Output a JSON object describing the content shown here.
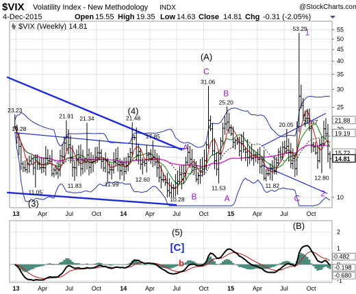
{
  "header": {
    "symbol": "$VIX",
    "name": "Volatility Index - New Methodology",
    "exchange": "INDX",
    "watermark": "@StockCharts.com",
    "date": "4-Dec-2015",
    "open_label": "Open",
    "open": "15.55",
    "high_label": "High",
    "high": "19.35",
    "low_label": "Low",
    "low": "14.63",
    "close_label": "Close",
    "close": "14.81",
    "chg_label": "Chg",
    "chg": "-0.31 (-2.05%)"
  },
  "legend": "$VIX (Weekly) 14.81",
  "colors": {
    "bars": "#000000",
    "ma_fast": "#d42020",
    "ma_slow": "#1a8a1a",
    "ma_long": "#e020c0",
    "bollinger": "#2030a0",
    "trend_lines": "#1a2adc",
    "wave_labels": "#9020c0",
    "macd_line": "#000000",
    "signal_line": "#c02020",
    "histogram": "#4a8a7a",
    "current_price_box": "#1a1a1a"
  },
  "chart_data": [
    {
      "type": "candlestick",
      "title": "$VIX (Weekly)",
      "y_scale": "log",
      "ylim": [
        9,
        60
      ],
      "y_ticks": [
        10,
        15,
        20,
        25,
        30,
        35,
        40,
        45,
        50,
        55
      ],
      "x_tick_labels": [
        "13",
        "Apr",
        "Jul",
        "Oct",
        "14",
        "Apr",
        "Jul",
        "Oct",
        "15",
        "Apr",
        "Jul",
        "Oct"
      ],
      "close_series": [
        {
          "x": "2012-12-28",
          "y": 20.5
        },
        {
          "x": "2013-01-25",
          "y": 13.5
        },
        {
          "x": "2013-02-22",
          "y": 14.8
        },
        {
          "x": "2013-03-22",
          "y": 13.5
        },
        {
          "x": "2013-04-19",
          "y": 14.5
        },
        {
          "x": "2013-05-17",
          "y": 12.8
        },
        {
          "x": "2013-06-21",
          "y": 18.5
        },
        {
          "x": "2013-07-19",
          "y": 13.5
        },
        {
          "x": "2013-08-16",
          "y": 14.5
        },
        {
          "x": "2013-09-13",
          "y": 14.2
        },
        {
          "x": "2013-10-11",
          "y": 15.7
        },
        {
          "x": "2013-11-08",
          "y": 12.9
        },
        {
          "x": "2013-12-06",
          "y": 14.8
        },
        {
          "x": "2014-01-03",
          "y": 13.0
        },
        {
          "x": "2014-01-31",
          "y": 18.4
        },
        {
          "x": "2014-02-28",
          "y": 14.0
        },
        {
          "x": "2014-03-28",
          "y": 15.5
        },
        {
          "x": "2014-04-25",
          "y": 13.5
        },
        {
          "x": "2014-05-23",
          "y": 11.6
        },
        {
          "x": "2014-06-20",
          "y": 11.0
        },
        {
          "x": "2014-07-18",
          "y": 12.0
        },
        {
          "x": "2014-08-08",
          "y": 15.8
        },
        {
          "x": "2014-09-05",
          "y": 12.0
        },
        {
          "x": "2014-10-03",
          "y": 14.5
        },
        {
          "x": "2014-10-17",
          "y": 21.9
        },
        {
          "x": "2014-11-14",
          "y": 13.3
        },
        {
          "x": "2014-12-12",
          "y": 21.1
        },
        {
          "x": "2015-01-09",
          "y": 17.5
        },
        {
          "x": "2015-02-06",
          "y": 17.3
        },
        {
          "x": "2015-03-06",
          "y": 15.2
        },
        {
          "x": "2015-04-03",
          "y": 14.7
        },
        {
          "x": "2015-05-01",
          "y": 12.7
        },
        {
          "x": "2015-06-05",
          "y": 14.2
        },
        {
          "x": "2015-07-10",
          "y": 16.8
        },
        {
          "x": "2015-08-07",
          "y": 13.4
        },
        {
          "x": "2015-08-21",
          "y": 28.0
        },
        {
          "x": "2015-09-18",
          "y": 22.3
        },
        {
          "x": "2015-10-02",
          "y": 17.1
        },
        {
          "x": "2015-10-23",
          "y": 14.5
        },
        {
          "x": "2015-11-13",
          "y": 20.1
        },
        {
          "x": "2015-12-04",
          "y": 14.81
        }
      ],
      "annotations": [
        {
          "label": "23.23",
          "x": "2012-12-28",
          "y": 23.23
        },
        {
          "label": "19.28",
          "x": "2013-01-11",
          "y": 19.28
        },
        {
          "label": "11.05",
          "x": "2013-03-08",
          "y": 11.05
        },
        {
          "label": "21.91",
          "x": "2013-06-21",
          "y": 21.91
        },
        {
          "label": "11.83",
          "x": "2013-07-19",
          "y": 11.83
        },
        {
          "label": "21.34",
          "x": "2013-08-30",
          "y": 21.34
        },
        {
          "label": "11.99",
          "x": "2013-11-22",
          "y": 11.99
        },
        {
          "label": "21.48",
          "x": "2014-02-03",
          "y": 21.48
        },
        {
          "label": "17.85",
          "x": "2014-04-11",
          "y": 17.85
        },
        {
          "label": "12.60",
          "x": "2014-03-07",
          "y": 12.6
        },
        {
          "label": "10.28",
          "x": "2014-07-03",
          "y": 10.28
        },
        {
          "label": "31.06",
          "x": "2014-10-15",
          "y": 31.06
        },
        {
          "label": "25.20",
          "x": "2014-12-16",
          "y": 25.2
        },
        {
          "label": "11.53",
          "x": "2014-11-21",
          "y": 11.53
        },
        {
          "label": "11.82",
          "x": "2015-05-22",
          "y": 11.82
        },
        {
          "label": "20.05",
          "x": "2015-07-08",
          "y": 20.05
        },
        {
          "label": "53.29",
          "x": "2015-08-24",
          "y": 53.29
        },
        {
          "label": "20.67",
          "x": "2015-09-29",
          "y": 20.67
        },
        {
          "label": "12.80",
          "x": "2015-11-06",
          "y": 12.8
        }
      ],
      "wave_labels": [
        {
          "label": "(A)",
          "x": "2014-10-10",
          "y": 40.5
        },
        {
          "label": "C",
          "x": "2014-10-10",
          "y": 35
        },
        {
          "label": "B",
          "x": "2014-12-16",
          "y": 28
        },
        {
          "label": "(4)",
          "x": "2014-02-03",
          "y": 23.3
        },
        {
          "label": "A",
          "x": "2014-07-31",
          "y": 16.1
        },
        {
          "label": "B",
          "x": "2014-08-29",
          "y": 9.8
        },
        {
          "label": "A",
          "x": "2014-12-19",
          "y": 9.6
        },
        {
          "label": "C",
          "x": "2015-08-14",
          "y": 9.6
        },
        {
          "label": "1",
          "x": "2015-09-18",
          "y": 52
        },
        {
          "label": "2",
          "x": "2015-11-10",
          "y": 10.1
        },
        {
          "label": "(3)",
          "x": "2013-03-01",
          "y": 9.1
        }
      ],
      "price_boxes": [
        {
          "label": "21.88",
          "y": 21.88
        },
        {
          "label": "19.19",
          "y": 19.19
        },
        {
          "label": "15.72",
          "y": 15.72
        },
        {
          "label": "14.81",
          "y": 14.81
        }
      ]
    },
    {
      "type": "line",
      "title": "MACD",
      "ylim": [
        -1.1,
        2.7
      ],
      "y_ticks": [
        -1,
        0,
        1,
        2
      ],
      "x_tick_labels": [
        "13",
        "Apr",
        "Jul",
        "Oct",
        "14",
        "Apr",
        "Jul",
        "Oct",
        "15",
        "Apr",
        "Jul",
        "Oct"
      ],
      "value_labels": [
        "0.482",
        "-0.198",
        "-0.680"
      ],
      "wave_labels": [
        "(5)",
        "[C]",
        "b",
        "(B)"
      ]
    }
  ]
}
